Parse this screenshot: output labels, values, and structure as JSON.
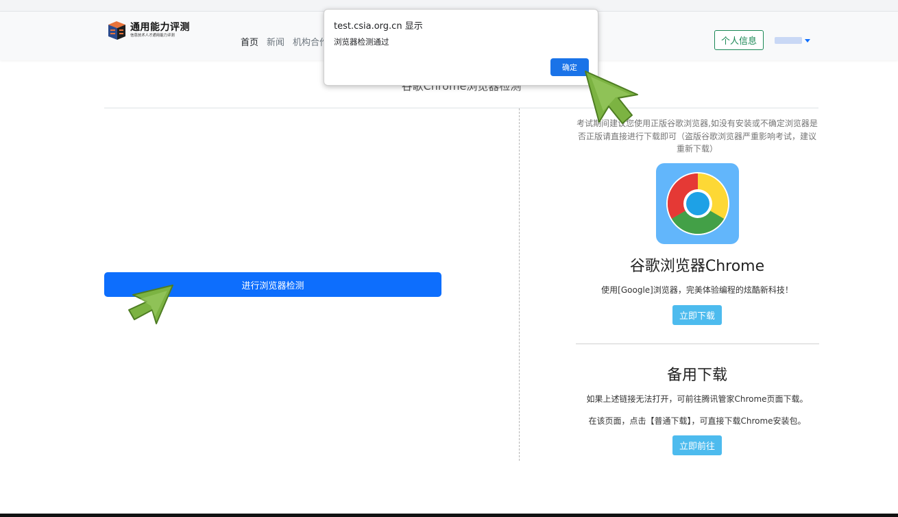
{
  "header": {
    "logo_title": "通用能力评测",
    "logo_subtitle": "信息技术人才通用能力评测",
    "nav": [
      "首页",
      "新闻",
      "机构合作"
    ],
    "profile_button": "个人信息"
  },
  "main": {
    "section_title": "谷歌Chrome浏览器检测",
    "detect_button": "进行浏览器检测"
  },
  "sidebar": {
    "advice": "考试期间建议您使用正版谷歌浏览器,如没有安装或不确定浏览器是否正版请直接进行下载即可（盗版谷歌浏览器严重影响考试，建议重新下载）",
    "chrome_title": "谷歌浏览器Chrome",
    "chrome_desc": "使用[Google]浏览器，完美体验编程的炫酷新科技！",
    "download_button": "立即下载",
    "backup_title": "备用下载",
    "backup_line1": "如果上述链接无法打开，可前往腾讯管家Chrome页面下载。",
    "backup_line2": "在该页面，点击【普通下载】，可直接下载Chrome安装包。",
    "goto_button": "立即前往"
  },
  "dialog": {
    "title": "test.csia.org.cn 显示",
    "message": "浏览器检测通过",
    "ok_button": "确定"
  },
  "colors": {
    "primary": "#0d6efd",
    "success": "#198754",
    "info": "#4dbbee",
    "dialog_button": "#1a73e8",
    "pointer": "#7cb342"
  }
}
